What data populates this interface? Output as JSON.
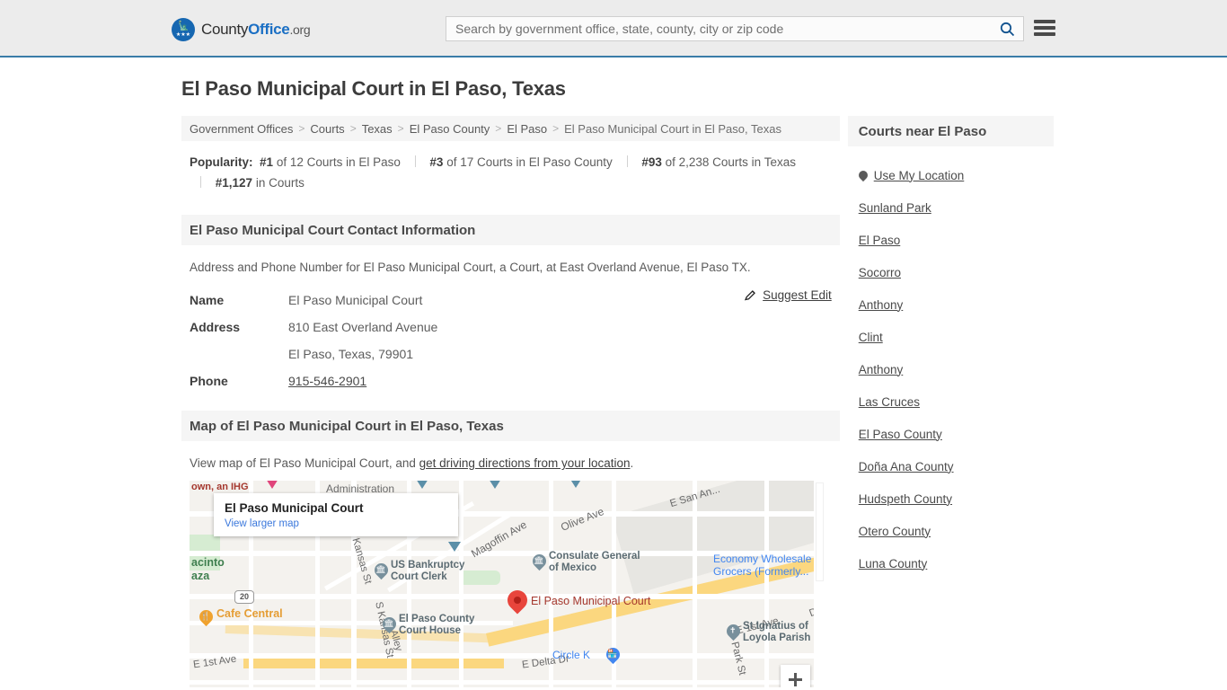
{
  "header": {
    "logo": {
      "part1": "County",
      "part2": "Office",
      "part3": ".org",
      "icon": "eagle-crest-icon"
    },
    "search": {
      "placeholder": "Search by government office, state, county, city or zip code",
      "value": ""
    },
    "search_icon": "search-icon",
    "menu_icon": "hamburger-menu-icon"
  },
  "page": {
    "title": "El Paso Municipal Court in El Paso, Texas"
  },
  "breadcrumb": {
    "items": [
      {
        "label": "Government Offices"
      },
      {
        "label": "Courts"
      },
      {
        "label": "Texas"
      },
      {
        "label": "El Paso County"
      },
      {
        "label": "El Paso"
      },
      {
        "label": "El Paso Municipal Court in El Paso, Texas"
      }
    ],
    "separator": ">"
  },
  "popularity": {
    "label": "Popularity:",
    "items": [
      {
        "rank": "#1",
        "text": " of 12 Courts in El Paso"
      },
      {
        "rank": "#3",
        "text": " of 17 Courts in El Paso County"
      },
      {
        "rank": "#93",
        "text": " of 2,238 Courts in Texas"
      },
      {
        "rank": "#1,127",
        "text": " in Courts"
      }
    ]
  },
  "contact": {
    "heading": "El Paso Municipal Court Contact Information",
    "description": "Address and Phone Number for El Paso Municipal Court, a Court, at East Overland Avenue, El Paso TX.",
    "rows": [
      {
        "label": "Name",
        "value": "El Paso Municipal Court"
      },
      {
        "label": "Address",
        "value": "810 East Overland Avenue"
      },
      {
        "label": "",
        "value": "El Paso, Texas, 79901"
      },
      {
        "label": "Phone",
        "value": "915-546-2901"
      }
    ],
    "suggest_edit": {
      "label": "Suggest Edit",
      "icon": "edit-pencil-icon"
    }
  },
  "map_section": {
    "heading": "Map of El Paso Municipal Court in El Paso, Texas",
    "description_prefix": "View map of El Paso Municipal Court, and ",
    "description_link": "get driving directions from your location",
    "description_suffix": ".",
    "card": {
      "title": "El Paso Municipal Court",
      "link": "View larger map"
    },
    "zoom_in_label": "+",
    "markers": [
      {
        "name": "El Paso Municipal Court",
        "type": "primary"
      },
      {
        "name": "US Bankruptcy Court Clerk",
        "type": "poi"
      },
      {
        "name": "Consulate General of Mexico",
        "type": "poi"
      },
      {
        "name": "El Paso County Court House",
        "type": "poi"
      },
      {
        "name": "St Ignatius of Loyola Parish",
        "type": "poi"
      },
      {
        "name": "Cafe Central",
        "type": "restaurant"
      },
      {
        "name": "Circle K",
        "type": "store"
      },
      {
        "name": "Economy Wholesale Grocers (Formerly...",
        "type": "store"
      }
    ],
    "labels": [
      "own, an IHG",
      "Administration",
      "acinto",
      "aza",
      "Magoffin Ave",
      "Olive Ave",
      "E San An...",
      "N Kansas St",
      "S Kansas St",
      "Alley",
      "E 1st Ave",
      "E Delta Dr",
      "Park St",
      "De",
      "20"
    ]
  },
  "sidebar": {
    "heading": "Courts near El Paso",
    "use_my_location": {
      "label": "Use My Location",
      "icon": "map-pin-icon"
    },
    "items": [
      {
        "label": "Sunland Park"
      },
      {
        "label": "El Paso"
      },
      {
        "label": "Socorro"
      },
      {
        "label": "Anthony"
      },
      {
        "label": "Clint"
      },
      {
        "label": "Anthony"
      },
      {
        "label": "Las Cruces"
      },
      {
        "label": "El Paso County"
      },
      {
        "label": "Doña Ana County"
      },
      {
        "label": "Hudspeth County"
      },
      {
        "label": "Otero County"
      },
      {
        "label": "Luna County"
      }
    ]
  },
  "colors": {
    "brand_blue": "#1b6fc4",
    "header_border": "#3a7ca8",
    "marker_red": "#e8453c",
    "link_blue": "#3b78dc"
  }
}
